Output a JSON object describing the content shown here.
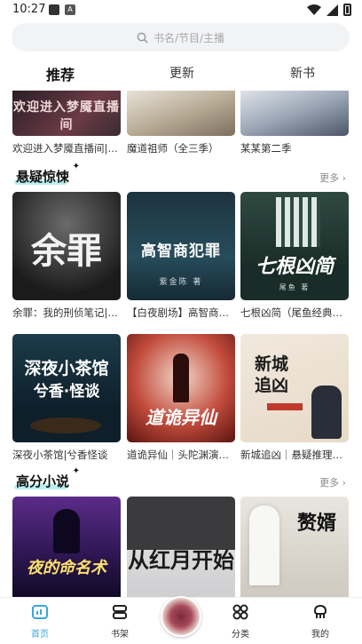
{
  "status": {
    "time": "10:27"
  },
  "search": {
    "placeholder": "书名/节目/主播"
  },
  "tabs": [
    {
      "label": "推荐"
    },
    {
      "label": "更新"
    },
    {
      "label": "新书"
    }
  ],
  "rows": {
    "top": [
      {
        "title": "欢迎进入梦魇直播间|…",
        "cover_text": "欢迎进入梦魇直播间"
      },
      {
        "title": "魔道祖师（全三季）",
        "cover_text": ""
      },
      {
        "title": "某某第二季",
        "cover_text": ""
      }
    ]
  },
  "section_suspense": {
    "title": "悬疑惊悚",
    "more": "更多",
    "items": [
      {
        "title": "余罪：我的刑侦笔记|…",
        "cover_text": "余罪"
      },
      {
        "title": "【白夜剧场】高智商…",
        "cover_text": "高智商犯罪",
        "cover_sub": "紫金陈 著"
      },
      {
        "title": "七根凶简（尾鱼经典…",
        "cover_text": "七根凶简",
        "cover_sub": "尾鱼 著"
      },
      {
        "title": "深夜小茶馆|兮香怪谈",
        "cover_text": "深夜小茶馆",
        "cover_text2": "兮香·怪谈"
      },
      {
        "title": "道诡异仙｜头陀渊演…",
        "cover_text": "道诡异仙"
      },
      {
        "title": "新城追凶｜悬疑推理…",
        "cover_text": "新城追凶"
      }
    ]
  },
  "section_novel": {
    "title": "高分小说",
    "more": "更多",
    "items": [
      {
        "cover_text": "夜的命名术"
      },
      {
        "cover_text": "从红月开始"
      },
      {
        "cover_text": "赘婿"
      }
    ]
  },
  "nav": [
    {
      "label": "首页"
    },
    {
      "label": "书架"
    },
    {
      "label": "分类"
    },
    {
      "label": "我的"
    }
  ],
  "colors": {
    "accent": "#3aa7d9",
    "section_highlight": "#b9eef0"
  }
}
